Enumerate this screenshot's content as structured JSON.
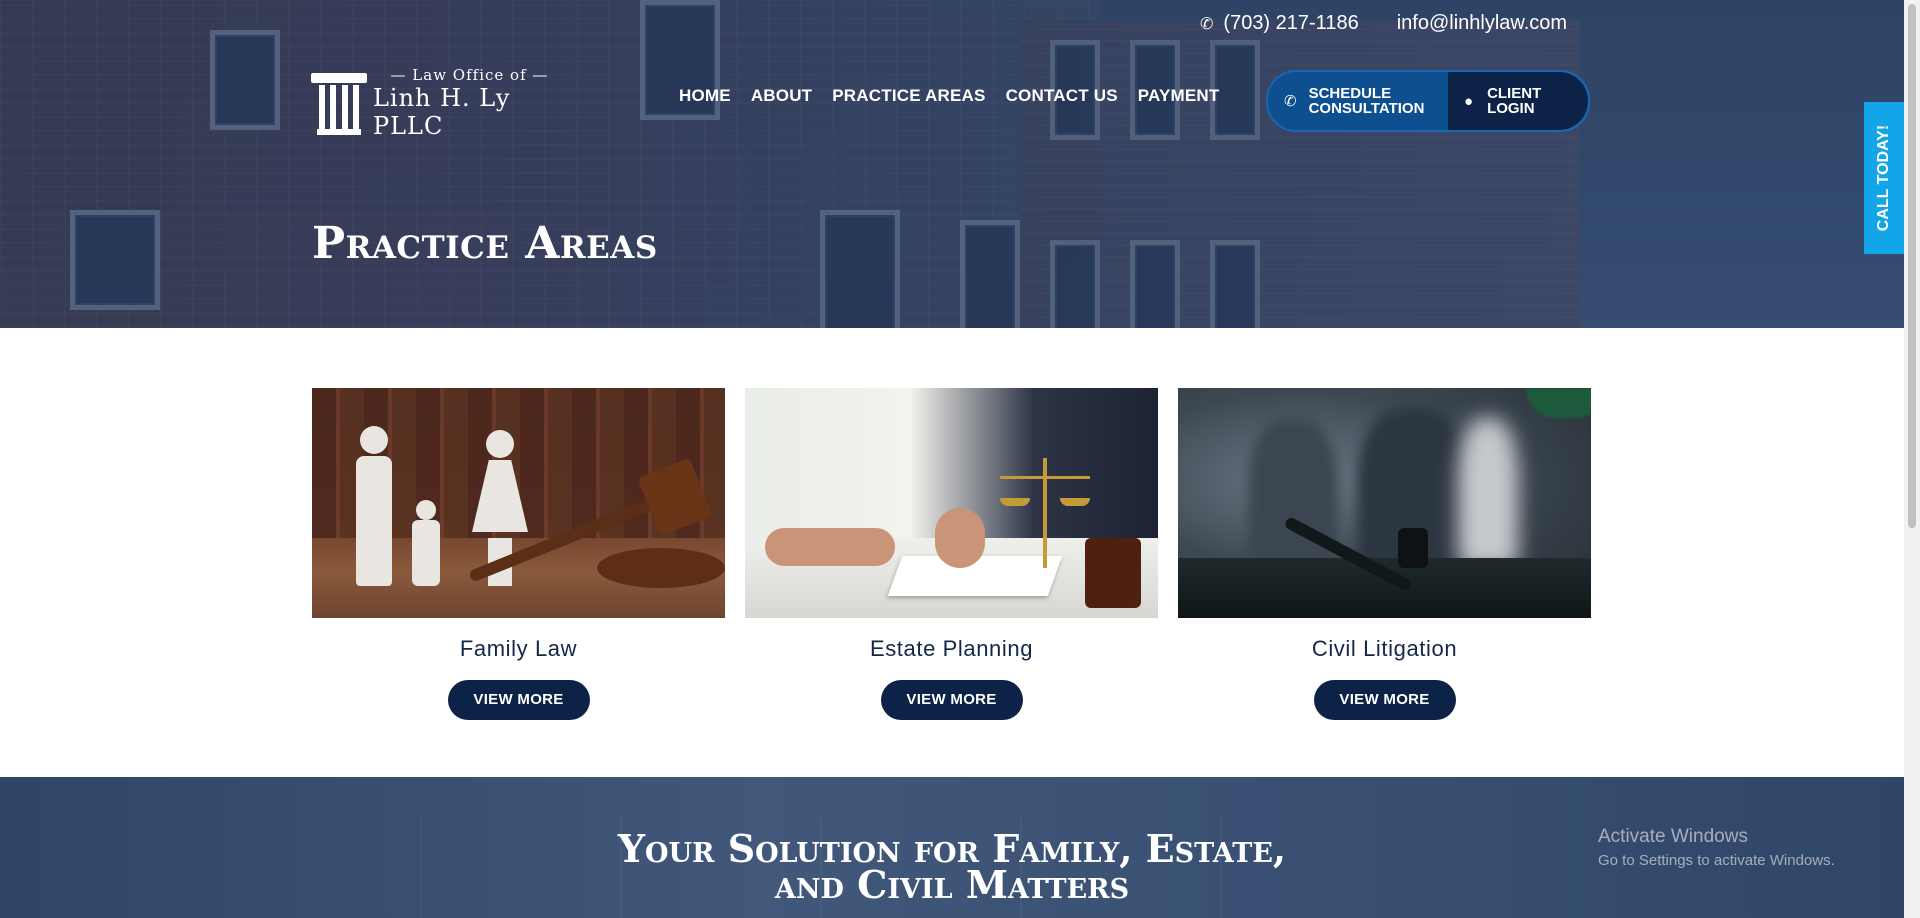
{
  "topbar": {
    "phone": "(703) 217-1186",
    "email": "info@linhlylaw.com",
    "phone_icon": "phone-icon"
  },
  "logo": {
    "line1": "— Law Office of —",
    "line2": "Linh H. Ly PLLC",
    "icon": "pillar-icon"
  },
  "nav": {
    "items": [
      "HOME",
      "ABOUT",
      "PRACTICE AREAS",
      "CONTACT US",
      "PAYMENT"
    ]
  },
  "cta": {
    "schedule_label": "SCHEDULE\nCONSULTATION",
    "login_label": "CLIENT\nLOGIN",
    "schedule_icon": "phone-icon",
    "login_icon": "user-icon",
    "color_schedule": "#0e4f8f",
    "color_login": "#0c2247"
  },
  "hero": {
    "title": "Practice Areas"
  },
  "call_today": {
    "label": "CALL TODAY!",
    "color": "#12a6e8"
  },
  "practice_cards": [
    {
      "title": "Family Law",
      "button": "VIEW MORE"
    },
    {
      "title": "Estate Planning",
      "button": "VIEW MORE"
    },
    {
      "title": "Civil Litigation",
      "button": "VIEW MORE"
    }
  ],
  "banner": {
    "line1": "Your Solution for Family, Estate,",
    "line2": "and Civil Matters"
  },
  "watermark": {
    "title": "Activate Windows",
    "subtitle": "Go to Settings to activate Windows."
  },
  "colors": {
    "navy": "#0c2247",
    "title_text": "#13274a",
    "accent_blue": "#12a6e8"
  }
}
